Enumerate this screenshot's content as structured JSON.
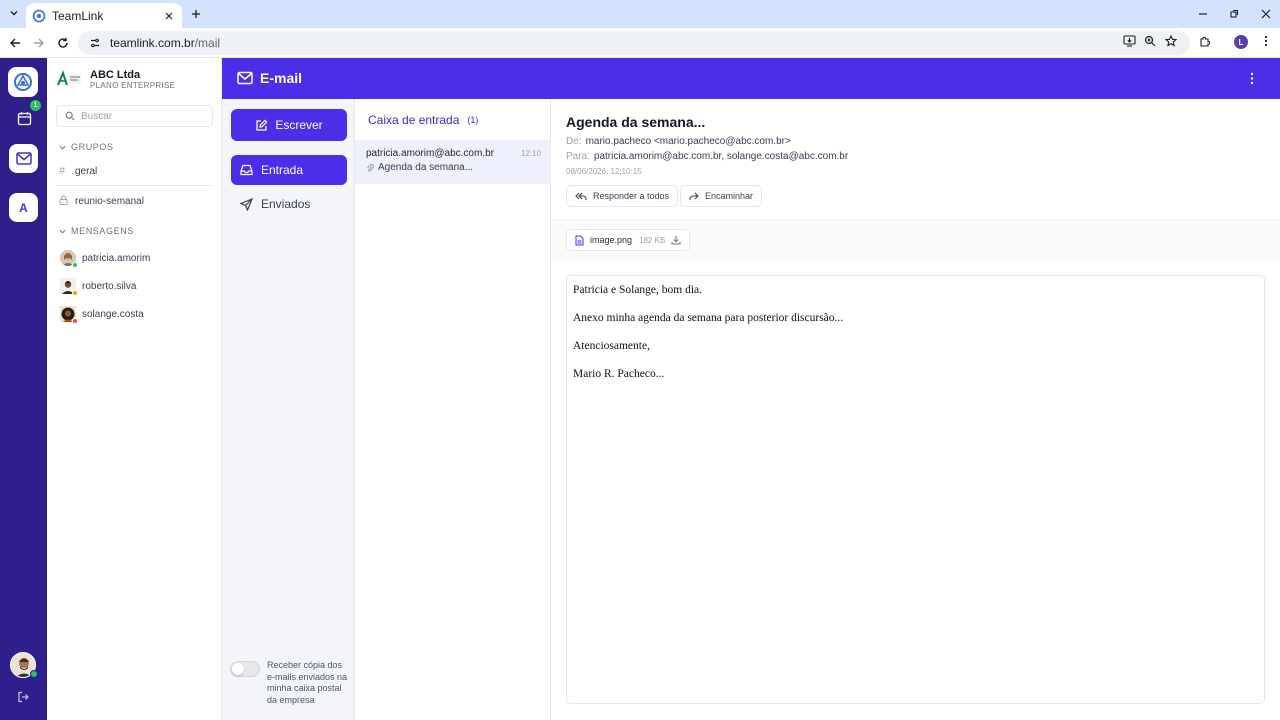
{
  "browser": {
    "tab_title": "TeamLink",
    "url_host": "teamlink.com.br",
    "url_path": "/mail",
    "profile_initial": "L"
  },
  "rail": {
    "calendar_badge": "1",
    "workspace_initial": "A"
  },
  "workspace": {
    "name": "ABC Ltda",
    "plan": "PLANO ENTERPRISE",
    "search_placeholder": "Buscar",
    "groups_label": "GRUPOS",
    "groups": [
      "geral",
      "reunio-semanal"
    ],
    "messages_label": "MENSAGENS",
    "contacts": [
      {
        "name": "patricia.amorim",
        "status_color": "#22c55e"
      },
      {
        "name": "roberto.silva",
        "status_color": "#f59e0b"
      },
      {
        "name": "solange.costa",
        "status_color": "#ef4444"
      }
    ]
  },
  "header": {
    "title": "E-mail"
  },
  "folders": {
    "compose_label": "Escrever",
    "inbox_label": "Entrada",
    "sent_label": "Enviados",
    "copy_label": "Receber cópia dos e-mails enviados na minha caixa postal da empresa",
    "copy_enabled": false
  },
  "message_list": {
    "title": "Caixa de entrada",
    "count": "(1)",
    "messages": [
      {
        "from": "patricia.amorim@abc.com.br",
        "time": "12:10",
        "subject": "Agenda da semana..."
      }
    ]
  },
  "reading": {
    "subject": "Agenda da semana...",
    "from_label": "De:",
    "from": "mario.pacheco <mario.pacheco@abc.com.br>",
    "to_label": "Para:",
    "to": "patricia.amorim@abc.com.br, solange.costa@abc.com.br",
    "date": "08/06/2026, 12:10:15",
    "reply_all_label": "Responder a todos",
    "forward_label": "Encaminhar",
    "attachment_name": "image.png",
    "attachment_size": "182 KB",
    "body": [
      "Patricia e Solange, bom dia.",
      "Anexo minha agenda da semana para posterior discursão...",
      "Atenciosamente,",
      "Mario R. Pacheco..."
    ]
  },
  "colors": {
    "brand": "#4a2ee8",
    "rail": "#2e1f8a",
    "online": "#22c55e"
  }
}
